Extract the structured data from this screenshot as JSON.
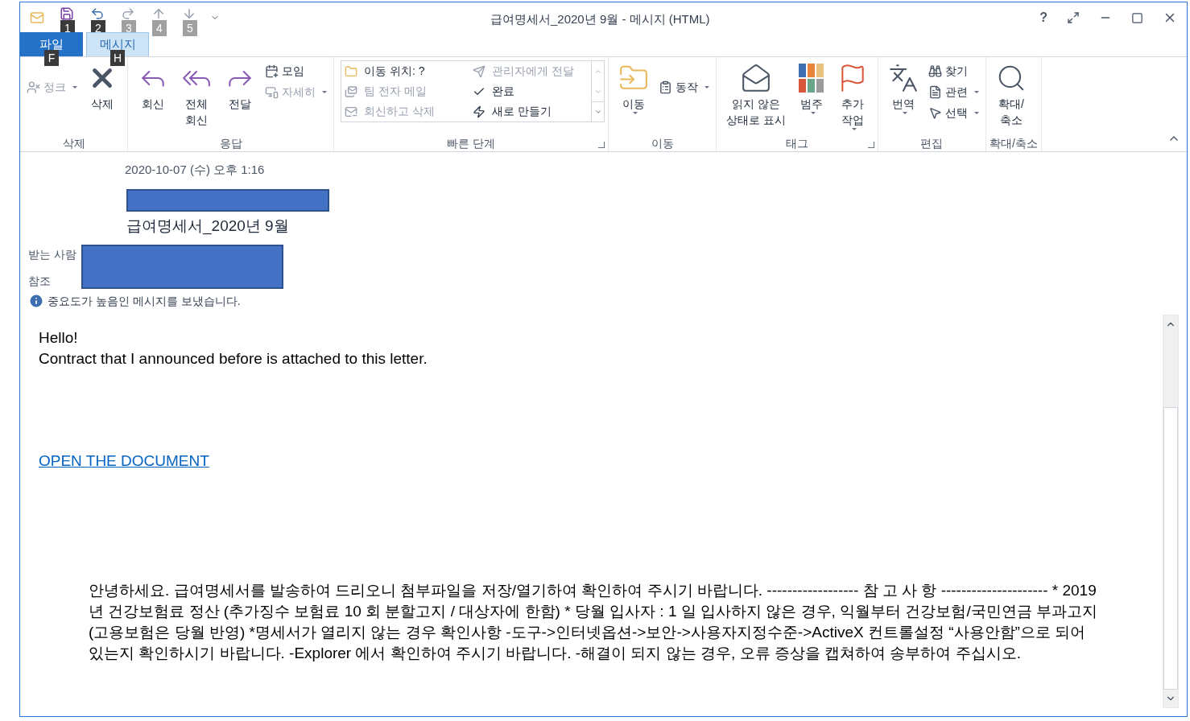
{
  "window": {
    "title": "급여명세서_2020년 9월 - 메시지 (HTML)",
    "help": "?"
  },
  "quick_access": [
    {
      "keytip": "1",
      "disabled": false
    },
    {
      "keytip": "2",
      "disabled": false
    },
    {
      "keytip": "3",
      "disabled": true
    },
    {
      "keytip": "4",
      "disabled": true
    },
    {
      "keytip": "5",
      "disabled": true
    }
  ],
  "tabs": [
    {
      "label": "파일",
      "kind": "file",
      "selected": false,
      "keytip": "F"
    },
    {
      "label": "메시지",
      "kind": "tab",
      "selected": true,
      "keytip": "H"
    }
  ],
  "ribbon": [
    {
      "label": "삭제",
      "launcher": false,
      "items": [
        {
          "kind": "small",
          "label": "정크",
          "disabled": true,
          "dropdown": true
        },
        {
          "kind": "large",
          "label": "삭제",
          "disabled": false,
          "dropdown": false
        }
      ]
    },
    {
      "label": "응답",
      "launcher": false,
      "items": [
        {
          "kind": "large",
          "label": "회신",
          "disabled": false,
          "dropdown": false
        },
        {
          "kind": "large",
          "label": "전체\n회신",
          "disabled": false,
          "dropdown": false
        },
        {
          "kind": "large",
          "label": "전달",
          "disabled": false,
          "dropdown": false
        },
        {
          "kind": "smallstack",
          "children": [
            {
              "label": "모임",
              "disabled": false,
              "dropdown": false
            },
            {
              "label": "자세히",
              "disabled": true,
              "dropdown": true
            }
          ]
        }
      ]
    },
    {
      "label": "빠른 단계",
      "launcher": true,
      "items": [
        {
          "kind": "gallery",
          "children": [
            {
              "label": "이동 위치: ?",
              "disabled": false
            },
            {
              "label": "관리자에게 전달",
              "disabled": true
            },
            {
              "label": "팀 전자 메일",
              "disabled": true
            },
            {
              "label": "완료",
              "disabled": false
            },
            {
              "label": "회신하고 삭제",
              "disabled": true
            },
            {
              "label": "새로 만들기",
              "disabled": false
            }
          ]
        }
      ]
    },
    {
      "label": "이동",
      "launcher": false,
      "items": [
        {
          "kind": "large",
          "label": "이동",
          "disabled": false,
          "dropdown": true
        },
        {
          "kind": "small",
          "label": "동작",
          "disabled": false,
          "dropdown": true
        }
      ]
    },
    {
      "label": "태그",
      "launcher": true,
      "items": [
        {
          "kind": "large",
          "label": "읽지 않은\n상태로 표시",
          "disabled": false,
          "dropdown": false
        },
        {
          "kind": "large",
          "label": "범주",
          "disabled": false,
          "dropdown": true
        },
        {
          "kind": "large",
          "label": "추가\n작업",
          "disabled": false,
          "dropdown": true
        }
      ]
    },
    {
      "label": "편집",
      "launcher": false,
      "items": [
        {
          "kind": "large",
          "label": "번역",
          "disabled": false,
          "dropdown": true
        },
        {
          "kind": "smallstack",
          "children": [
            {
              "label": "찾기",
              "disabled": false,
              "dropdown": false
            },
            {
              "label": "관련",
              "disabled": false,
              "dropdown": true
            },
            {
              "label": "선택",
              "disabled": false,
              "dropdown": true
            }
          ]
        }
      ]
    },
    {
      "label": "확대/축소",
      "launcher": false,
      "items": [
        {
          "kind": "large",
          "label": "확대/\n축소",
          "disabled": false,
          "dropdown": false
        }
      ]
    }
  ],
  "message": {
    "date": "2020-10-07 (수) 오후 1:16",
    "subject": "급여명세서_2020년 9월",
    "to_label": "받는 사람",
    "cc_label": "참조",
    "info": "중요도가 높음인 메시지를 보냈습니다."
  },
  "body": {
    "lines": [
      "Hello!",
      "Contract that I announced before is attached to this letter."
    ],
    "link": "OPEN THE DOCUMENT",
    "notice": "안녕하세요. 급여명세서를 발송하여 드리오니 첨부파일을 저장/열기하여 확인하여 주시기 바랍니다. ------------------ 참 고 사 항 --------------------- * 2019 년 건강보험료 정산 (추가징수 보험료 10 회 분할고지 / 대상자에 한함) * 당월 입사자 : 1 일 입사하지 않은 경우, 익월부터 건강보험/국민연금 부과고지 (고용보험은 당월 반영) *명세서가 열리지 않는 경우 확인사항 -도구->인터넷옵션->보안->사용자지정수준->ActiveX 컨트롤설정 “사용안함”으로 되어 있는지 확인하시기 바랍니다. -Explorer 에서 확인하여 주시기 바랍니다. -해결이 되지 않는 경우, 오류 증상을 캡쳐하여 송부하여 주십시오."
  }
}
